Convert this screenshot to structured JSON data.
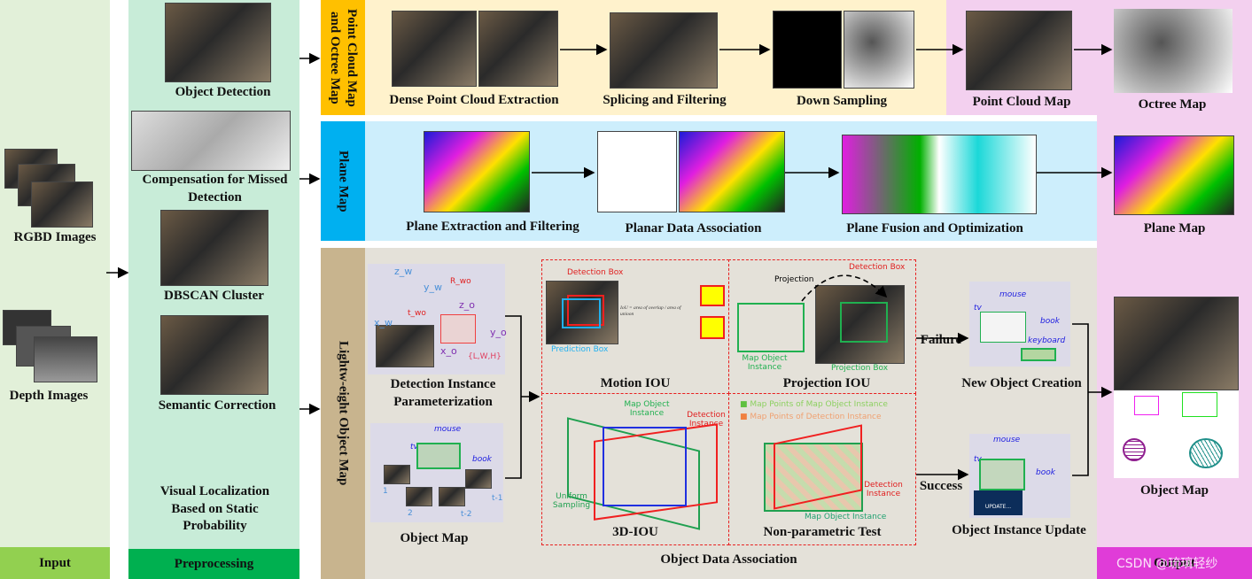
{
  "columns": {
    "input": "Input",
    "preprocessing": "Preprocessing",
    "output": "Output"
  },
  "input": {
    "rgbd": "RGBD Images",
    "depth": "Depth Images"
  },
  "preprocessing": {
    "object_detection": "Object Detection",
    "compensation": "Compensation for Missed Detection",
    "dbscan": "DBSCAN Cluster",
    "semantic": "Semantic Correction",
    "localization": "Visual Localization Based on Static Probability"
  },
  "point_cloud_row": {
    "title": "Point Cloud Map and Octree Map",
    "dense": "Dense Point Cloud Extraction",
    "splicing": "Splicing and Filtering",
    "down": "Down Sampling",
    "pcmap": "Point Cloud Map",
    "octree": "Octree Map"
  },
  "plane_row": {
    "title": "Plane Map",
    "extraction": "Plane Extraction and Filtering",
    "association": "Planar Data Association",
    "fusion": "Plane Fusion and Optimization",
    "planemap": "Plane Map"
  },
  "object_row": {
    "title": "Lightw-eight Object Map",
    "param": "Detection Instance Parameterization",
    "param_labels": {
      "zw": "z_w",
      "yw": "y_w",
      "xw": "x_w",
      "rwo": "R_wo",
      "two": "t_wo",
      "zo": "z_o",
      "yo": "y_o",
      "xo": "x_o",
      "lwh": "{L,W,H}"
    },
    "objmap": "Object Map",
    "objmap_labels": {
      "mouse": "mouse",
      "tv": "tv",
      "book": "book",
      "f1": "1",
      "f2": "2",
      "ft1": "t-1",
      "ft2": "t-2"
    },
    "motion_iou": "Motion IOU",
    "detection_box": "Detection Box",
    "prediction_box": "Prediction Box",
    "iou_formula": "IoU = area of overlap / area of unioon",
    "projection_iou": "Projection IOU",
    "projection": "Projection",
    "projection_box": "Projection Box",
    "map_object_instance": "Map Object Instance",
    "iou3d": "3D-IOU",
    "detection_instance": "Detection Instance",
    "uniform_sampling": "Uniform Sampling",
    "nonparam": "Non-parametric Test",
    "legend_map_points": "Map Points of Map Object Instance",
    "legend_det_points": "Map Points of  Detection Instance",
    "association": "Object Data Association",
    "failure": "Failure",
    "success": "Success",
    "new_object": "New Object Creation",
    "keyboard": "keyboard",
    "update": "Object Instance Update",
    "update_btn": "UPDATE...",
    "final_map": "Object Map"
  },
  "watermark": "CSDN @琉璃轻纱",
  "colors": {
    "input_bg": "#e2f0d9",
    "input_bar": "#92d050",
    "pre_bg": "#c8ecd8",
    "pre_bar": "#00b050",
    "pc_bg": "#fff2cc",
    "pc_strip": "#ffc000",
    "plane_bg": "#cdeefc",
    "plane_strip": "#00b0f0",
    "obj_bg": "#e4e1d9",
    "obj_strip": "#c8b48e",
    "out_bg": "#f3d0ef",
    "out_bar": "#e03cd8",
    "dash": "#e82020"
  }
}
